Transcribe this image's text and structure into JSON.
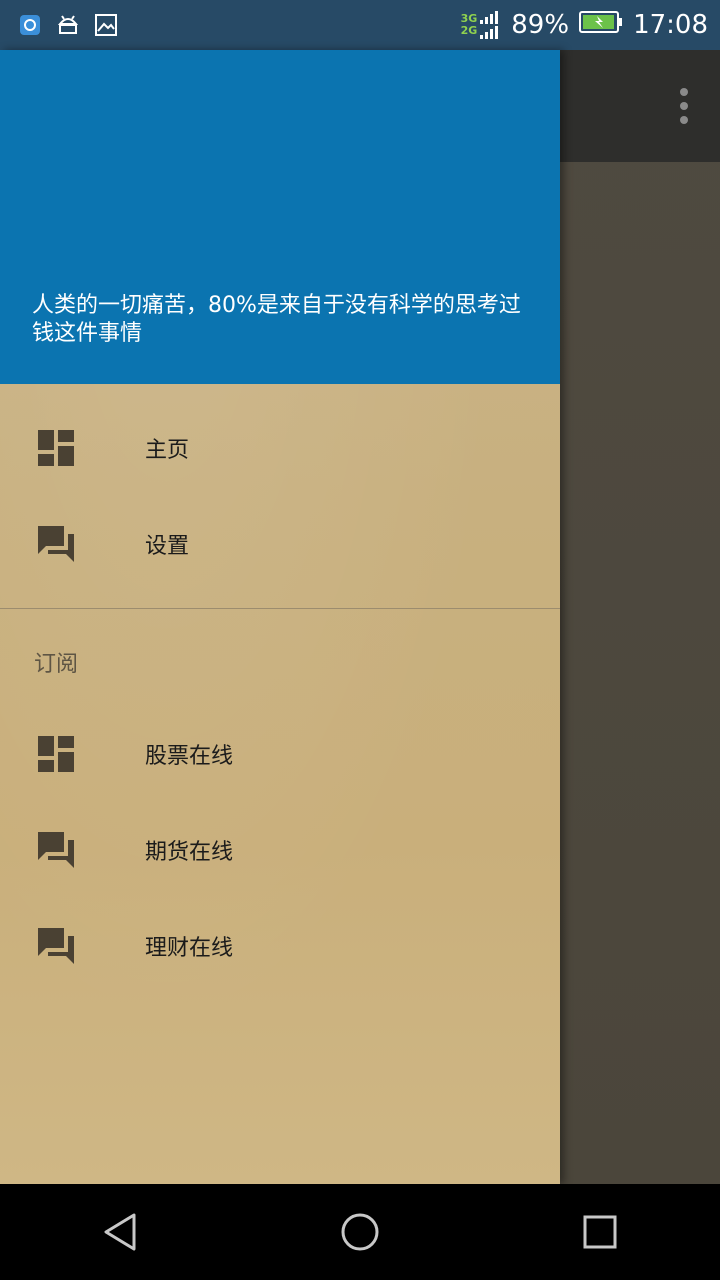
{
  "status_bar": {
    "battery_percent": "89%",
    "time": "17:08",
    "net_top": "3G",
    "net_bottom": "2G",
    "icons": [
      "app-notification-icon",
      "android-icon",
      "image-icon",
      "signal-icon",
      "battery-charging-icon"
    ]
  },
  "toolbar": {
    "overflow_icon": "more-vert-icon"
  },
  "drawer": {
    "header_quote": "人类的一切痛苦，80%是来自于没有科学的思考过钱这件事情",
    "items": [
      {
        "label": "主页",
        "icon": "dashboard-icon"
      },
      {
        "label": "设置",
        "icon": "forum-icon"
      }
    ],
    "section_title": "订阅",
    "sub_items": [
      {
        "label": "股票在线",
        "icon": "dashboard-icon"
      },
      {
        "label": "期货在线",
        "icon": "forum-icon"
      },
      {
        "label": "理财在线",
        "icon": "forum-icon"
      }
    ]
  },
  "nav_bar": {
    "buttons": [
      "back-icon",
      "home-icon",
      "recents-icon"
    ]
  },
  "colors": {
    "header_blue": "#0b74b0",
    "status_bar": "#274a66",
    "icon_dark": "#4a4133"
  }
}
